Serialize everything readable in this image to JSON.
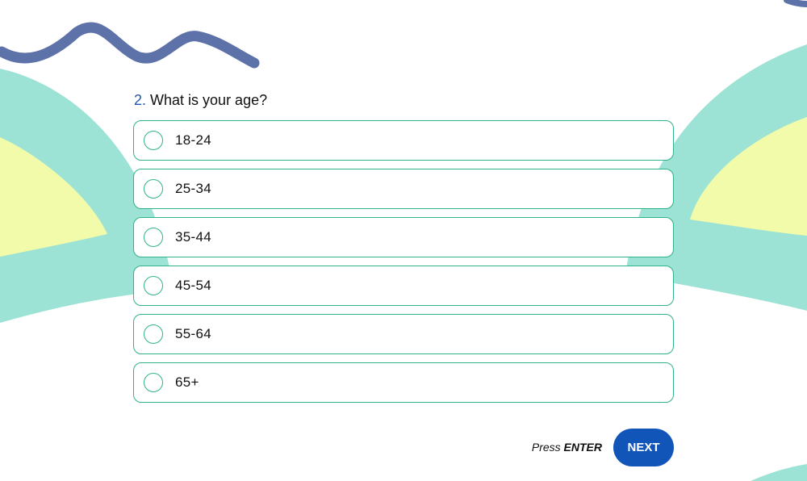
{
  "question": {
    "number": "2.",
    "text": "What is your age?"
  },
  "options": [
    {
      "label": "18-24"
    },
    {
      "label": "25-34"
    },
    {
      "label": "35-44"
    },
    {
      "label": "45-54"
    },
    {
      "label": "55-64"
    },
    {
      "label": "65+"
    }
  ],
  "footer": {
    "hint_prefix": "Press",
    "hint_key": "ENTER",
    "next_label": "NEXT"
  },
  "colors": {
    "accent": "#2fb38a",
    "button": "#1155b8",
    "question_number": "#2456a8",
    "wave_blue": "#5d72a8",
    "teal_shape": "#9ce3d5",
    "yellow_shape": "#f2fbaa"
  }
}
